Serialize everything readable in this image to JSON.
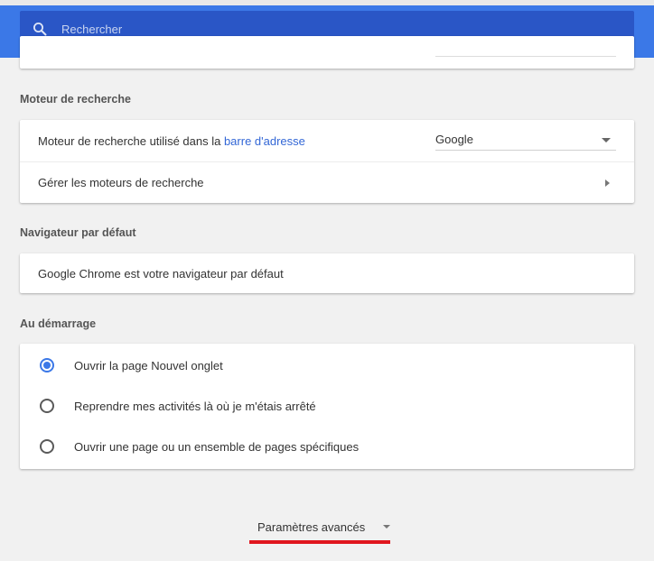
{
  "search": {
    "placeholder": "Rechercher"
  },
  "search_engine_section": {
    "title": "Moteur de recherche",
    "engine_label_prefix": "Moteur de recherche utilisé dans la ",
    "engine_label_link": "barre d'adresse",
    "engine_value": "Google",
    "manage_label": "Gérer les moteurs de recherche"
  },
  "default_browser_section": {
    "title": "Navigateur par défaut",
    "status": "Google Chrome est votre navigateur par défaut"
  },
  "startup_section": {
    "title": "Au démarrage",
    "options": [
      {
        "label": "Ouvrir la page Nouvel onglet",
        "checked": true
      },
      {
        "label": "Reprendre mes activités là où je m'étais arrêté",
        "checked": false
      },
      {
        "label": "Ouvrir une page ou un ensemble de pages spécifiques",
        "checked": false
      }
    ]
  },
  "advanced": {
    "label": "Paramètres avancés"
  },
  "colors": {
    "accent": "#3b78e7",
    "header": "#3b78e7",
    "search_bg": "#2a56c6",
    "highlight": "#e0161e",
    "link": "#3367d6"
  },
  "icons": {
    "search": "search-icon",
    "dropdown": "chevron-down-icon",
    "submenu": "chevron-right-icon"
  }
}
